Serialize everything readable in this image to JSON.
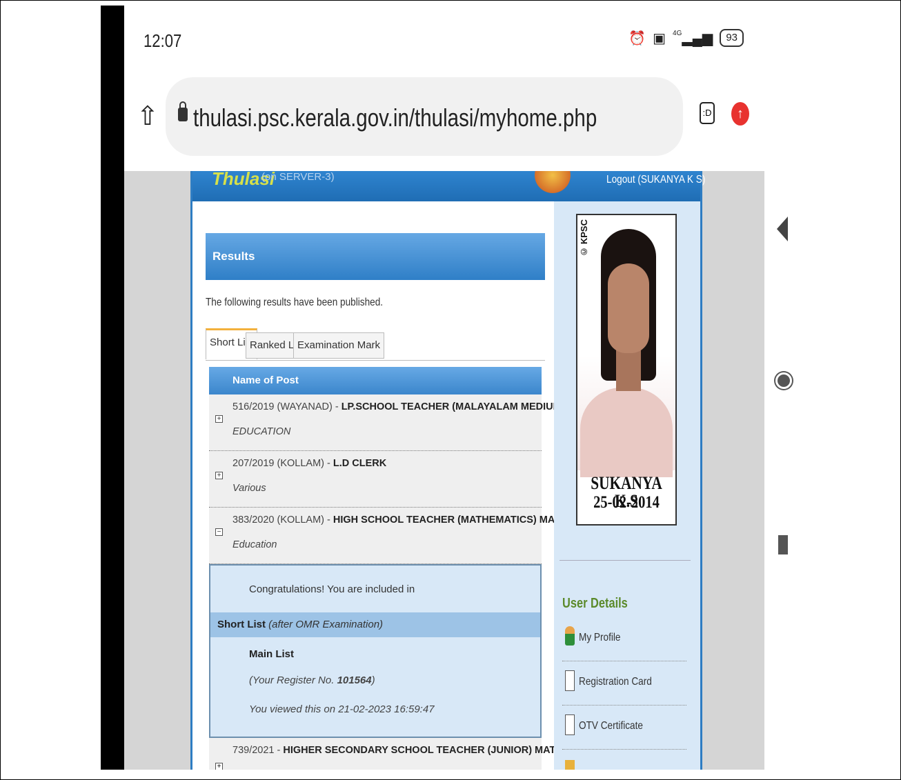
{
  "status_bar": {
    "time": "12:07",
    "network": "4G",
    "battery": "93"
  },
  "browser": {
    "url": "thulasi.psc.kerala.gov.in/thulasi/myhome.php",
    "tabs_label": ":D"
  },
  "site_header": {
    "logo": "Thulasi",
    "server": "(on SERVER-3)",
    "logout": "Logout (SUKANYA K S)"
  },
  "results": {
    "title": "Results",
    "intro": "The following results have been published.",
    "tabs": [
      {
        "label": "Short List",
        "active": true
      },
      {
        "label": "Ranked List",
        "active": false
      },
      {
        "label": "Examination Mark",
        "active": false
      }
    ],
    "table_header": "Name of Post",
    "posts": [
      {
        "code": "516/2019 (WAYANAD) - ",
        "name": "LP.SCHOOL TEACHER (MALAYALAM MEDIUM)",
        "dept": "EDUCATION",
        "toggle": "+"
      },
      {
        "code": "207/2019 (KOLLAM) - ",
        "name": "L.D CLERK",
        "dept": "Various",
        "toggle": "+"
      },
      {
        "code": "383/2020 (KOLLAM) - ",
        "name": "HIGH SCHOOL TEACHER (MATHEMATICS) MALAYALAM MEDIUM",
        "dept": "Education",
        "toggle": "−"
      }
    ],
    "detail": {
      "congrats": "Congratulations! You are included in",
      "list_type": "Short List",
      "list_note": " (after OMR Examination)",
      "main_list": "Main List",
      "register_prefix": "(Your Register No. ",
      "register_no": "101564",
      "register_suffix": ")",
      "viewed": "You viewed this on 21-02-2023 16:59:47"
    },
    "last_post": {
      "code": "739/2021 - ",
      "name": "HIGHER SECONDARY SCHOOL TEACHER (JUNIOR) MATHEMATICS",
      "toggle": "+"
    }
  },
  "sidebar": {
    "photo_watermark": "© KPSC",
    "photo_name": "SUKANYA K.S",
    "photo_date": "25-02-2014",
    "section_title": "User Details",
    "links": [
      {
        "label": "My Profile",
        "icon": "user-icon"
      },
      {
        "label": "Registration Card",
        "icon": "card-icon"
      },
      {
        "label": "OTV Certificate",
        "icon": "certificate-icon"
      }
    ]
  }
}
